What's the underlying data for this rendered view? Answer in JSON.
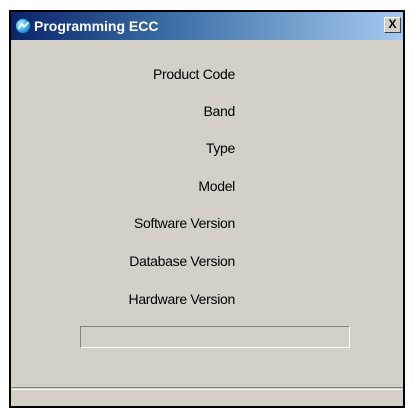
{
  "window": {
    "title": "Programming ECC",
    "close_label": "X"
  },
  "labels": [
    "Product Code",
    "Band",
    "Type",
    "Model",
    "Software Version",
    "Database Version",
    "Hardware Version"
  ],
  "progress": {
    "value": 0
  },
  "status": {
    "text": ""
  },
  "colors": {
    "title_start": "#0a246a",
    "title_end": "#a6caf0",
    "face": "#d4d0c8"
  }
}
